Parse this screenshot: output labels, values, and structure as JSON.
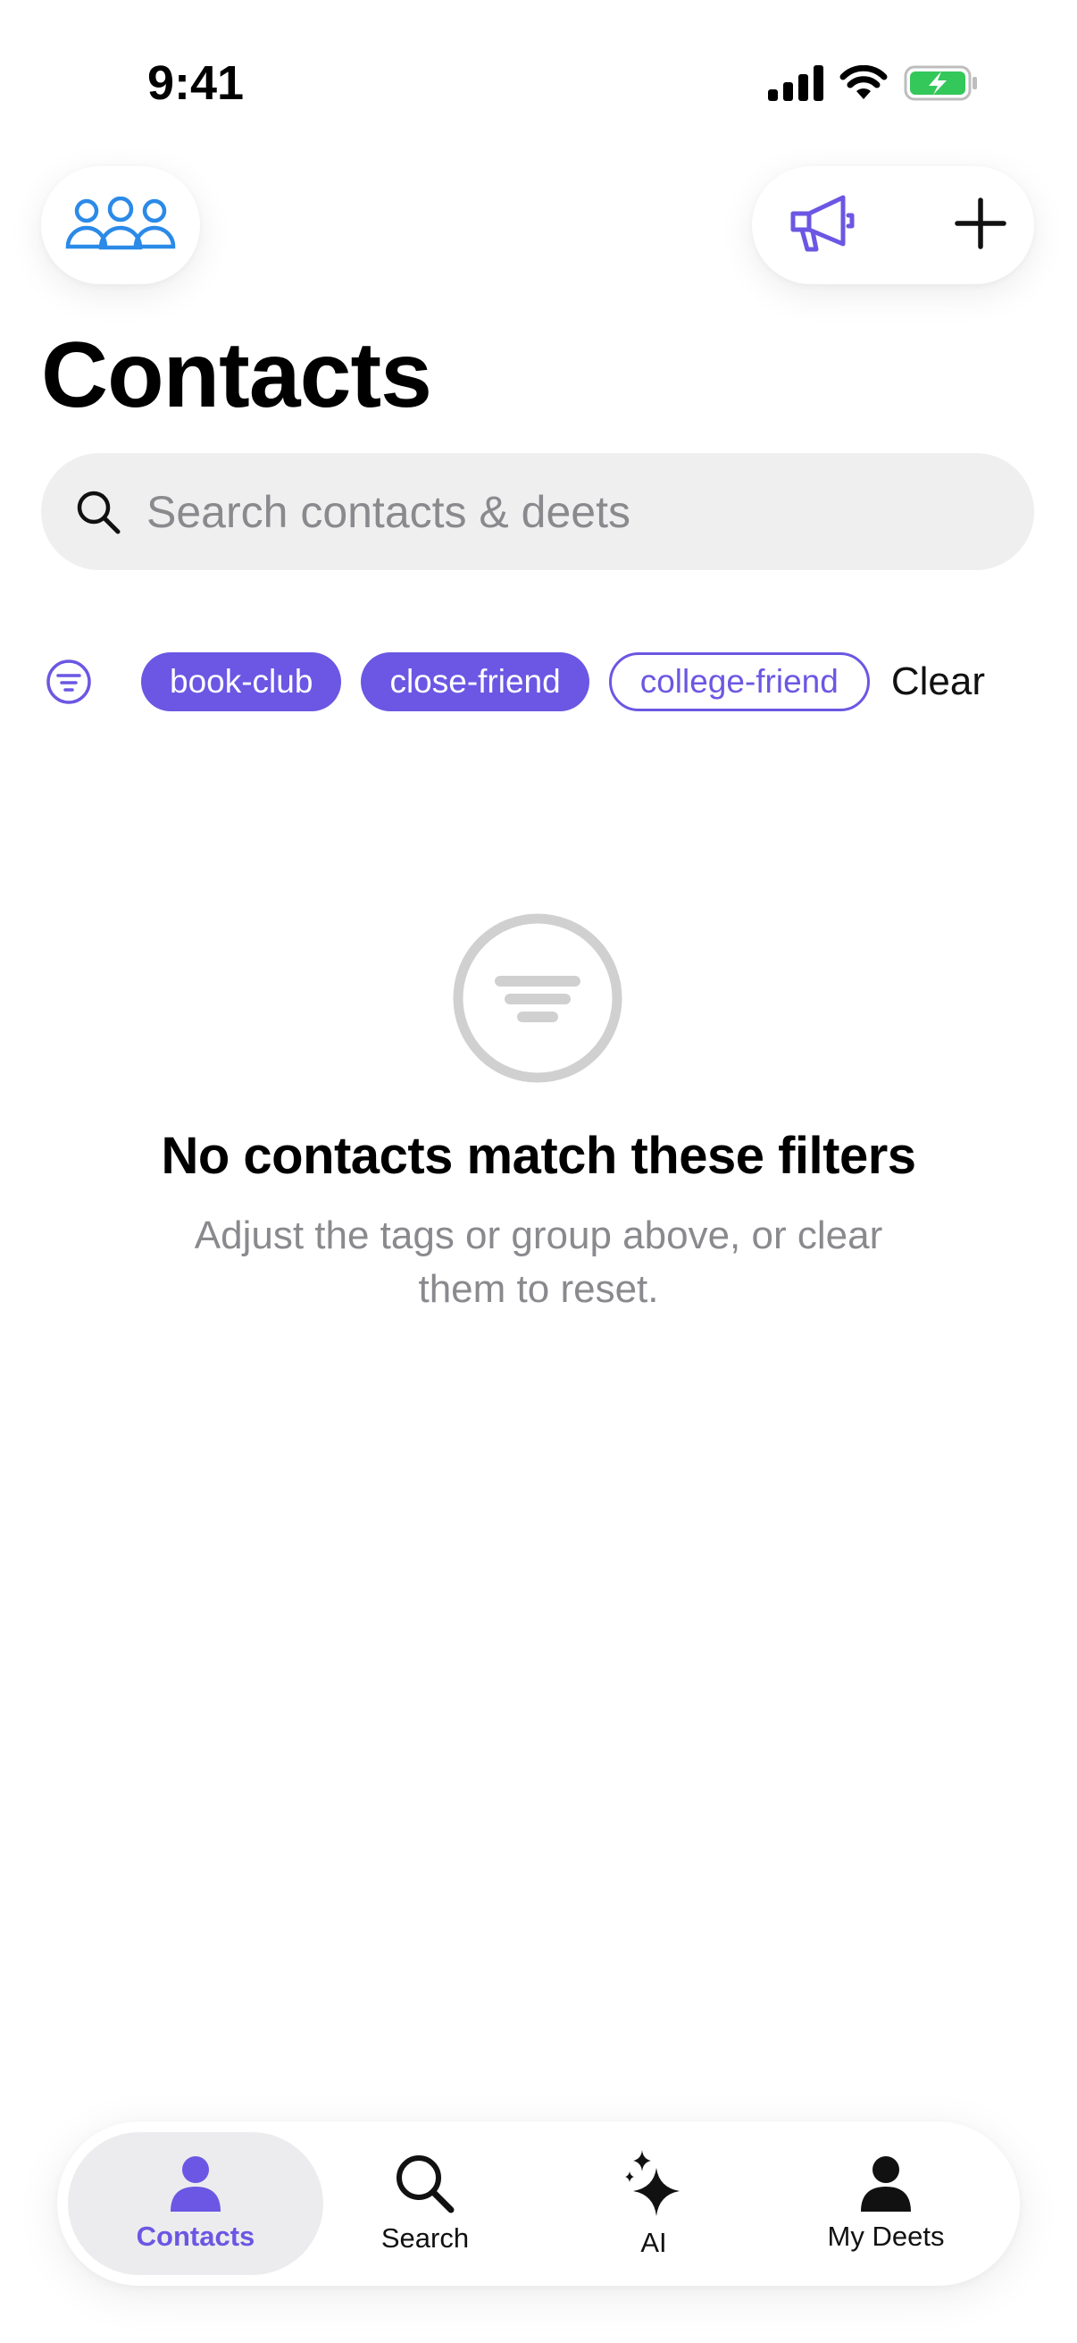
{
  "status_bar": {
    "time": "9:41"
  },
  "header": {
    "groups_icon": "people-group-icon",
    "announcement_icon": "megaphone-icon",
    "add_icon": "plus-icon",
    "title": "Contacts"
  },
  "search": {
    "placeholder": "Search contacts & deets",
    "value": ""
  },
  "filters": {
    "icon": "filter-icon",
    "chips": [
      {
        "label": "book-club",
        "selected": true
      },
      {
        "label": "close-friend",
        "selected": true
      },
      {
        "label": "college-friend",
        "selected": false
      }
    ],
    "clear_label": "Clear"
  },
  "empty_state": {
    "icon": "filter-circle-icon",
    "title": "No contacts match these filters",
    "subtitle": "Adjust the tags or group above, or clear them to reset."
  },
  "tab_bar": {
    "tabs": [
      {
        "label": "Contacts",
        "icon": "person-icon",
        "active": true
      },
      {
        "label": "Search",
        "icon": "search-icon",
        "active": false
      },
      {
        "label": "AI",
        "icon": "sparkles-icon",
        "active": false
      },
      {
        "label": "My Deets",
        "icon": "person-icon",
        "active": false
      }
    ]
  },
  "colors": {
    "accent": "#6b57e3",
    "groups_icon": "#2b8ae8",
    "battery_green": "#34c759"
  }
}
